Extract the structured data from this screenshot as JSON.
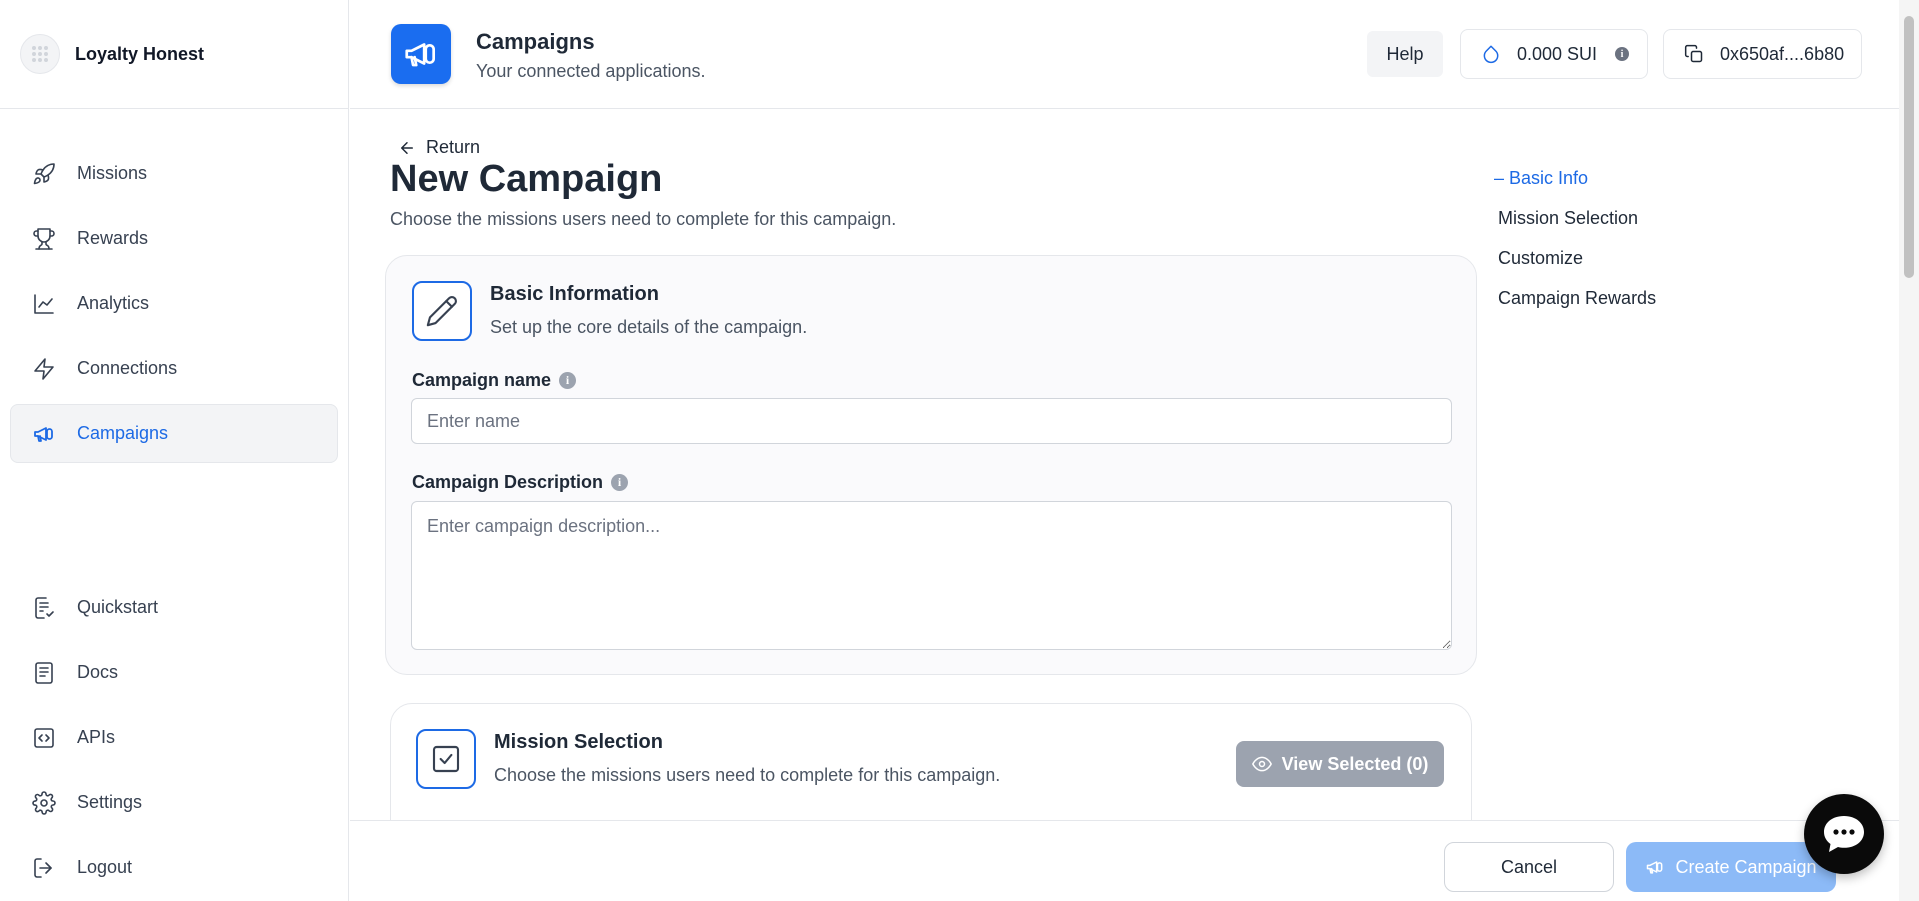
{
  "sidebar": {
    "brand_name": "Loyalty Honest",
    "items_top": [
      {
        "label": "Missions",
        "icon": "rocket-icon"
      },
      {
        "label": "Rewards",
        "icon": "trophy-icon"
      },
      {
        "label": "Analytics",
        "icon": "chart-line-icon"
      },
      {
        "label": "Connections",
        "icon": "lightning-icon"
      },
      {
        "label": "Campaigns",
        "icon": "megaphone-icon",
        "active": true
      }
    ],
    "items_bottom": [
      {
        "label": "Quickstart",
        "icon": "checklist-icon"
      },
      {
        "label": "Docs",
        "icon": "document-icon"
      },
      {
        "label": "APIs",
        "icon": "code-icon"
      },
      {
        "label": "Settings",
        "icon": "gear-icon"
      },
      {
        "label": "Logout",
        "icon": "logout-icon"
      }
    ]
  },
  "header": {
    "title": "Campaigns",
    "subtitle": "Your connected applications.",
    "help_label": "Help",
    "balance": "0.000 SUI",
    "wallet": "0x650af....6b80"
  },
  "main": {
    "return_label": "Return",
    "title": "New Campaign",
    "subtitle": "Choose the missions users need to complete for this campaign."
  },
  "toc": {
    "items": [
      "– Basic Info",
      "Mission Selection",
      "Customize",
      "Campaign Rewards"
    ]
  },
  "basic_info": {
    "title": "Basic Information",
    "subtitle": "Set up the core details of the campaign.",
    "name_label": "Campaign name",
    "name_value": "",
    "name_placeholder": "Enter name",
    "desc_label": "Campaign Description",
    "desc_value": "",
    "desc_placeholder": "Enter campaign description..."
  },
  "mission_selection": {
    "title": "Mission Selection",
    "subtitle": "Choose the missions users need to complete for this campaign.",
    "view_selected_label": "View Selected (0)"
  },
  "footer": {
    "cancel_label": "Cancel",
    "create_label": "Create Campaign"
  },
  "colors": {
    "accent": "#1d6ae5",
    "header_icon_bg": "#1a6df0",
    "create_button_disabled": "#8cbaf7",
    "view_button_disabled": "#9ca3af"
  }
}
